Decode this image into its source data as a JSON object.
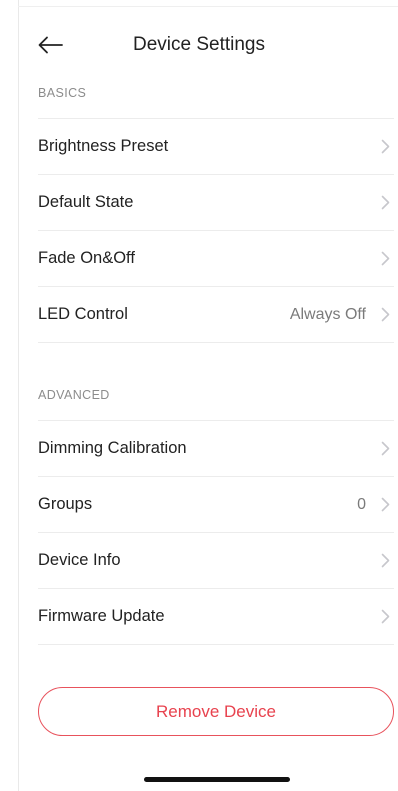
{
  "header": {
    "title": "Device Settings",
    "back_icon": "arrow-left-icon"
  },
  "sections": {
    "basics": {
      "label": "BASICS",
      "items": [
        {
          "label": "Brightness Preset",
          "value": ""
        },
        {
          "label": "Default State",
          "value": ""
        },
        {
          "label": "Fade On&Off",
          "value": ""
        },
        {
          "label": "LED Control",
          "value": "Always Off"
        }
      ]
    },
    "advanced": {
      "label": "ADVANCED",
      "items": [
        {
          "label": "Dimming Calibration",
          "value": ""
        },
        {
          "label": "Groups",
          "value": "0"
        },
        {
          "label": "Device Info",
          "value": ""
        },
        {
          "label": "Firmware Update",
          "value": ""
        }
      ]
    }
  },
  "actions": {
    "remove_label": "Remove Device"
  },
  "colors": {
    "danger": "#e8424e",
    "chevron": "#c7c7cc",
    "divider": "#ececec",
    "section_text": "#8c8c8c"
  }
}
